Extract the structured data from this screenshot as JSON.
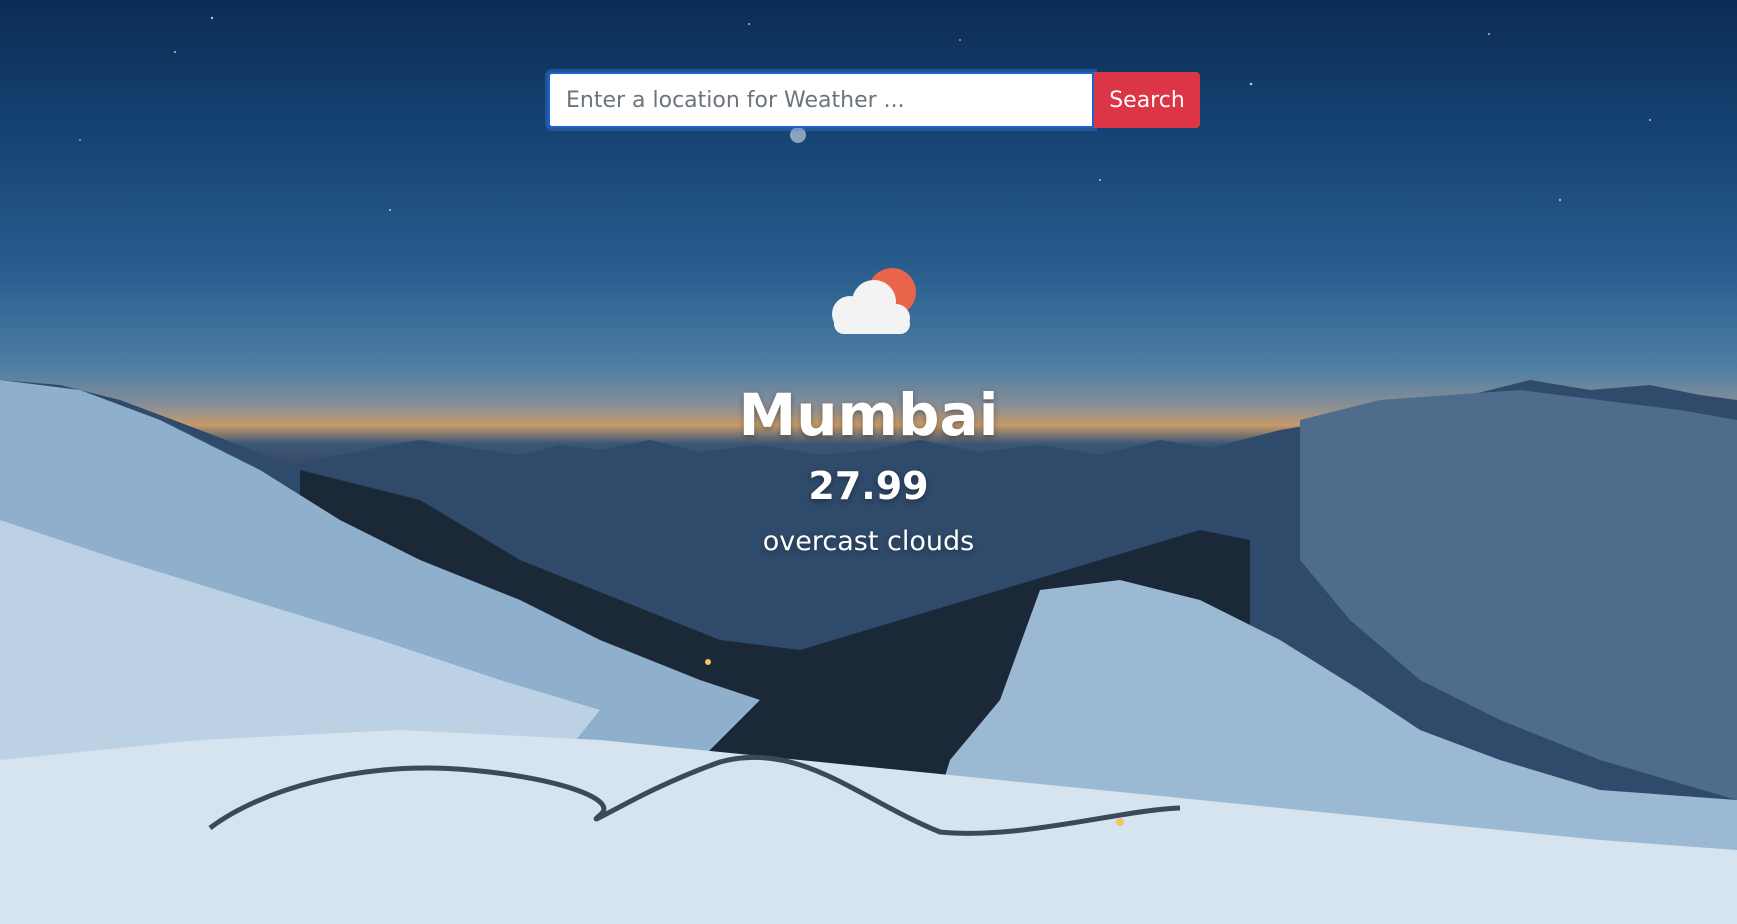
{
  "search": {
    "placeholder": "Enter a location for Weather ...",
    "value": "",
    "button_label": "Search"
  },
  "weather": {
    "icon": "cloud-sun-icon",
    "city": "Mumbai",
    "temperature": "27.99",
    "description": "overcast clouds"
  },
  "colors": {
    "search_button": "#dc3545",
    "input_border": "#1e63c9",
    "sun": "#e8644a",
    "text": "#ffffff"
  }
}
